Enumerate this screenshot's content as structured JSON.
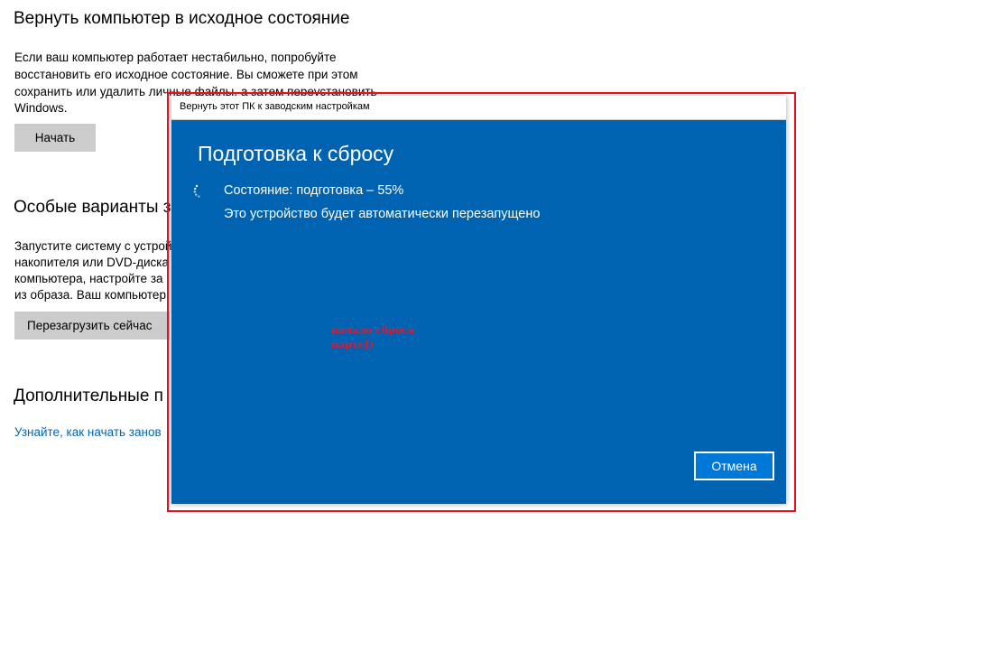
{
  "settings_page": {
    "reset_section": {
      "title": "Вернуть компьютер в исходное состояние",
      "description_lines": [
        "Если ваш компьютер работает нестабильно, попробуйте",
        "восстановить его исходное состояние. Вы сможете при этом",
        "сохранить или удалить личные файлы, а затем переустановить",
        "Windows."
      ],
      "start_button": "Начать"
    },
    "special_boot_section": {
      "title": "Особые варианты з",
      "description_lines": [
        "Запустите систему с устрой",
        "накопителя или DVD-диска",
        "компьютера, настройте за",
        "из образа. Ваш компьютер"
      ],
      "restart_button": "Перезагрузить сейчас"
    },
    "additional_section": {
      "title": "Дополнительные п",
      "link": "Узнайте, как начать занов"
    }
  },
  "dialog": {
    "window_title": "Вернуть этот ПК к заводским настройкам",
    "heading": "Подготовка к сбросу",
    "status": "Состояние: подготовка – 55%",
    "progress_percent": 55,
    "restart_note": "Это устройство будет автоматически перезапущено",
    "cancel_button": "Отмена",
    "annotation_lines": [
      "начало сброса",
      "парте])"
    ],
    "spinner_icon": "loading-spinner-icon"
  },
  "colors": {
    "dialog_background": "#0063b1",
    "accent_button": "#0078d7",
    "link": "#0066b4",
    "highlight_border": "#e8101c",
    "annotation": "#e8142b"
  }
}
